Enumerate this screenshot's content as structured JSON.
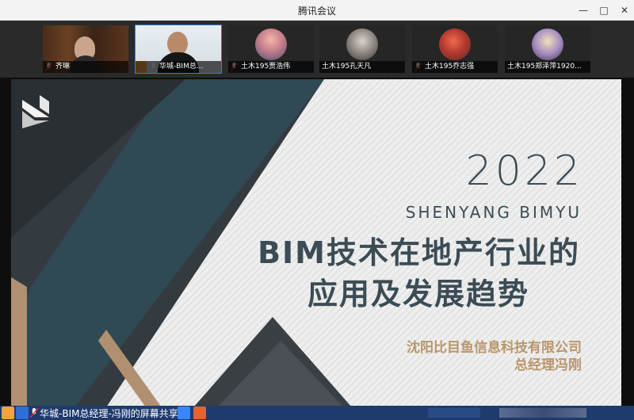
{
  "window": {
    "title": "腾讯会议"
  },
  "participants": [
    {
      "name": "齐琳"
    },
    {
      "name": "华城-BIM总..."
    },
    {
      "name": "土木195贾浩伟"
    },
    {
      "name": "土木195孔天凡"
    },
    {
      "name": "土木195乔志强"
    },
    {
      "name": "土木195郑泽萍1920..."
    }
  ],
  "slide": {
    "year": "2022",
    "subtitle": "SHENYANG BIMYU",
    "title_line1": "BIM技术在地产行业的",
    "title_line2": "应用及发展趋势",
    "company": "沈阳比目鱼信息科技有限公司",
    "presenter": "总经理冯刚"
  },
  "sharebar": {
    "label": "华城-BIM总经理-冯刚的屏幕共享"
  },
  "colors": {
    "slide_dark": "#3c4c55",
    "slide_teal": "#2f4a55",
    "slide_gold": "#b8966c",
    "sharebar": "#1f3b6e"
  }
}
